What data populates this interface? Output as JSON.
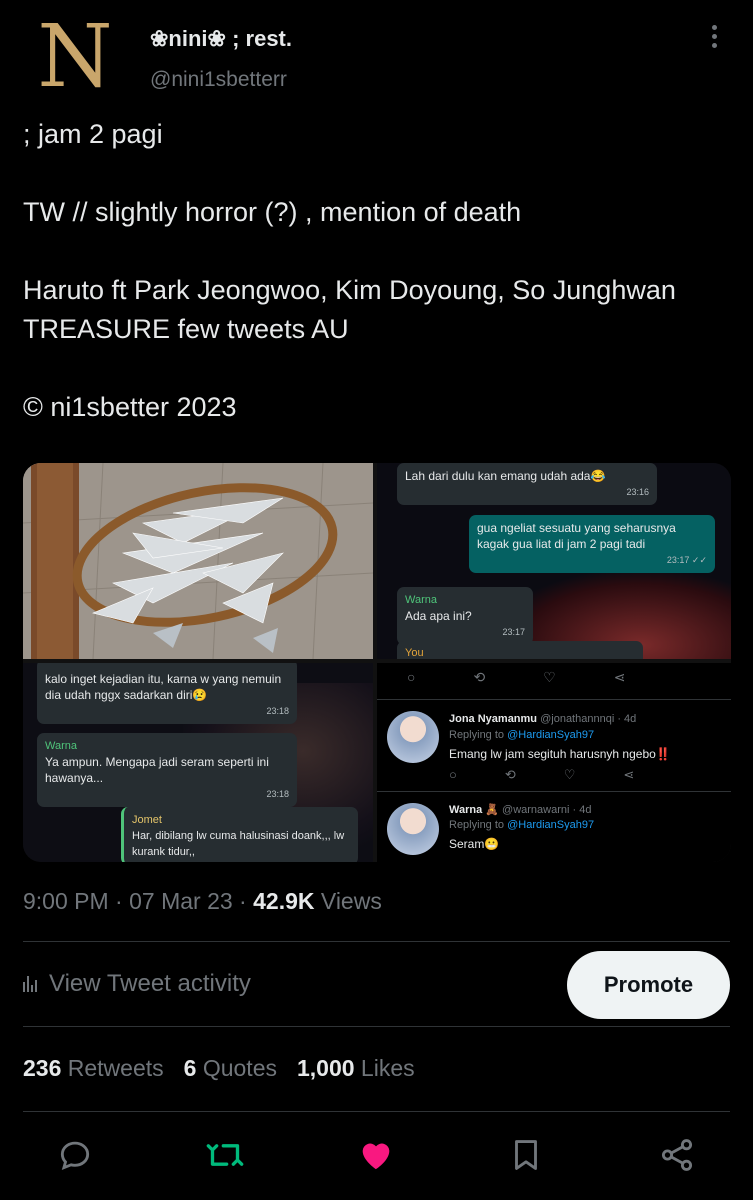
{
  "author": {
    "display_name": "❀nini❀ ; rest.",
    "handle": "@nini1sbetterr",
    "avatar_letter": "N",
    "avatar_color": "#c9a66b"
  },
  "tweet": {
    "lines": [
      "; jam 2 pagi",
      "TW // slightly horror (?) , mention of death",
      "Haruto ft Park Jeongwoo, Kim Doyoung, So Junghwan TREASURE few tweets AU",
      "© ni1sbetter 2023"
    ]
  },
  "media": {
    "chat1": {
      "msg1": {
        "text": "Lah dari dulu kan emang udah ada😂",
        "time": "23:16"
      },
      "msg2": {
        "text": "gua ngeliat sesuatu yang seharusnya kagak gua liat di jam 2 pagi tadi",
        "time": "23:17 ✓✓"
      },
      "msg3": {
        "sender": "Warna",
        "text": "Ada apa ini?",
        "time": "23:17"
      },
      "msg4": {
        "sender": "You"
      }
    },
    "chat2": {
      "msg1": {
        "text": "kalo inget kejadian itu, karna w yang nemuin dia udah nggx sadarkan diri😢",
        "time": "23:18"
      },
      "msg2": {
        "sender": "Warna",
        "text": "Ya ampun. Mengapa jadi seram seperti ini hawanya...",
        "time": "23:18"
      },
      "msg3": {
        "sender": "Jomet",
        "text": "Har, dibilang lw cuma halusinasi doank,,, lw kurank tidur,,"
      }
    },
    "replies": [
      {
        "name": "Jona Nyamanmu",
        "handle": "@jonathannnqi · 4d",
        "replying_label": "Replying to",
        "replying_to": "@HardianSyah97",
        "text": "Emang lw jam segituh harusnyh ngebo‼️"
      },
      {
        "name": "Warna 🧸",
        "handle": "@warnawarni · 4d",
        "replying_label": "Replying to",
        "replying_to": "@HardianSyah97",
        "text": "Seram😬"
      }
    ]
  },
  "meta": {
    "time": "9:00 PM",
    "sep1": " · ",
    "date": "07 Mar 23",
    "sep2": " · ",
    "views_count": "42.9K",
    "views_label": " Views"
  },
  "activity": {
    "label": "View Tweet activity",
    "promote_label": "Promote"
  },
  "stats": {
    "retweets_count": "236",
    "retweets_label": " Retweets",
    "quotes_count": "6",
    "quotes_label": " Quotes",
    "likes_count": "1,000",
    "likes_label": " Likes"
  },
  "actions": {
    "reply_icon": "speech-bubble-icon",
    "retweet_icon": "retweet-icon",
    "like_icon": "heart-icon",
    "bookmark_icon": "bookmark-icon",
    "share_icon": "share-icon",
    "retweet_color": "#00ba7c",
    "like_color": "#f91880"
  }
}
